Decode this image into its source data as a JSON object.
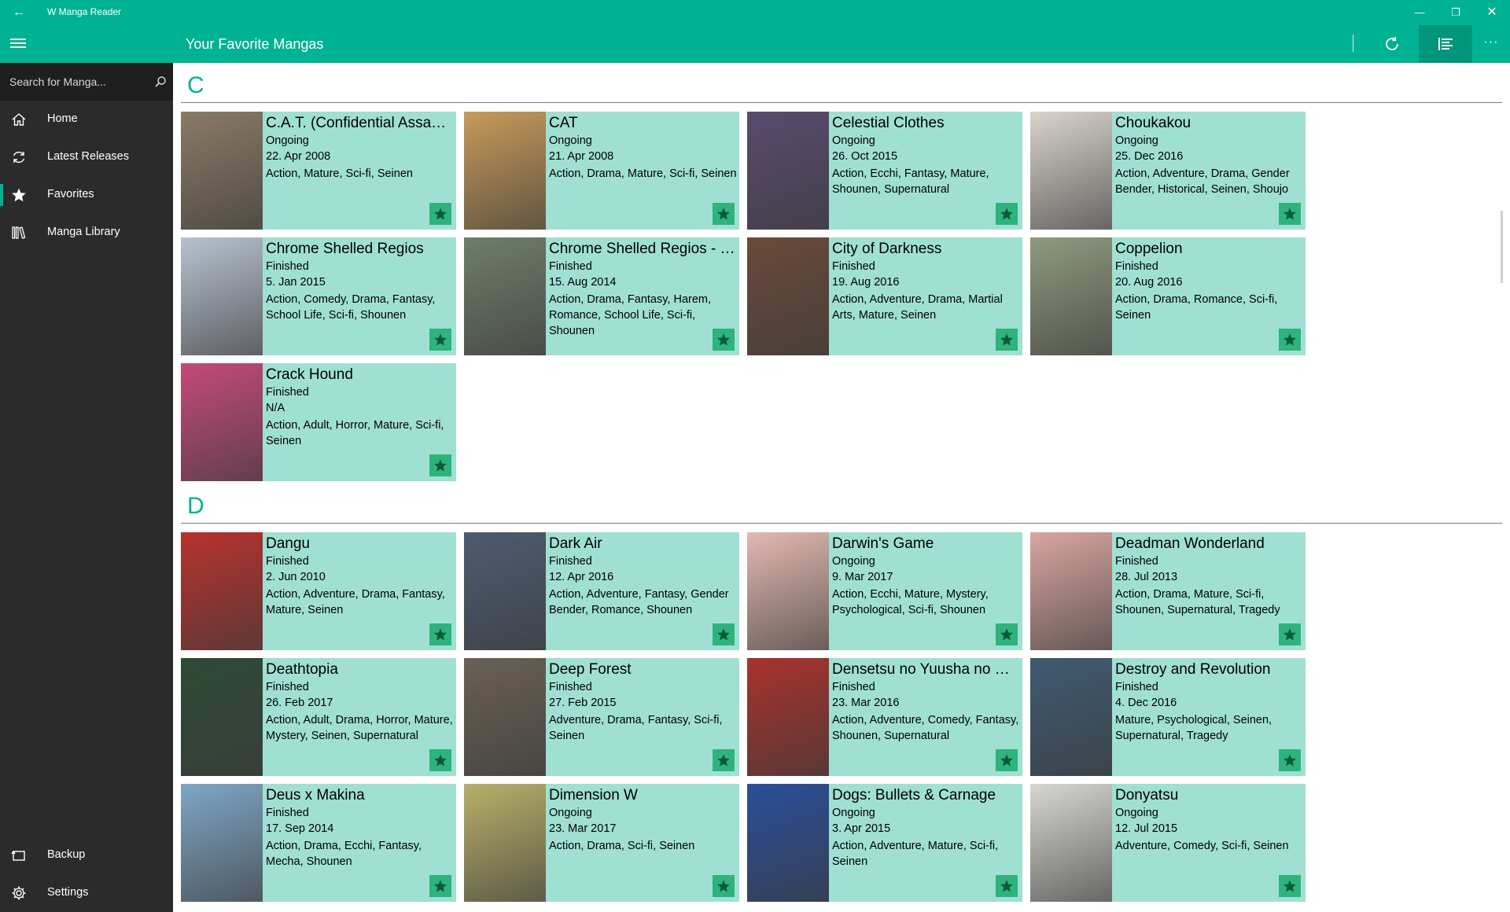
{
  "app": {
    "title": "W Manga Reader"
  },
  "header": {
    "page_title": "Your Favorite Mangas"
  },
  "colors": {
    "accent": "#00b294",
    "card_bg": "#9fe0d3",
    "star_bg": "#2fb37c",
    "sidebar_bg": "#2b2b2b"
  },
  "sidebar": {
    "search_placeholder": "Search for Manga...",
    "items": [
      {
        "label": "Home",
        "icon": "home-icon"
      },
      {
        "label": "Latest Releases",
        "icon": "refresh-icon"
      },
      {
        "label": "Favorites",
        "icon": "star-icon",
        "selected": true
      },
      {
        "label": "Manga Library",
        "icon": "library-icon"
      }
    ],
    "bottom_items": [
      {
        "label": "Backup",
        "icon": "backup-icon"
      },
      {
        "label": "Settings",
        "icon": "gear-icon"
      }
    ]
  },
  "groups": [
    {
      "letter": "C",
      "mangas": [
        {
          "title": "C.A.T. (Confidential Assassination Troop)",
          "status": "Ongoing",
          "date": "22. Apr 2008",
          "genres": "Action, Mature, Sci-fi, Seinen",
          "cover_color": "#8a7a66"
        },
        {
          "title": "CAT",
          "status": "Ongoing",
          "date": "21. Apr 2008",
          "genres": "Action, Drama, Mature, Sci-fi, Seinen",
          "cover_color": "#c79a5a"
        },
        {
          "title": "Celestial Clothes",
          "status": "Ongoing",
          "date": "26. Oct 2015",
          "genres": "Action, Ecchi, Fantasy, Mature, Shounen, Supernatural",
          "cover_color": "#5a4b6e"
        },
        {
          "title": "Choukakou",
          "status": "Ongoing",
          "date": "25. Dec 2016",
          "genres": "Action, Adventure, Drama, Gender Bender, Historical, Seinen, Shoujo",
          "cover_color": "#d9d4cc"
        },
        {
          "title": "Chrome Shelled Regios",
          "status": "Finished",
          "date": "5. Jan 2015",
          "genres": "Action, Comedy, Drama, Fantasy, School Life, Sci-fi, Shounen",
          "cover_color": "#b8c2cf"
        },
        {
          "title": "Chrome Shelled Regios - Missing Mail",
          "status": "Finished",
          "date": "15. Aug 2014",
          "genres": "Action, Drama, Fantasy, Harem, Romance, School Life, Sci-fi, Shounen",
          "cover_color": "#6f7d6a"
        },
        {
          "title": "City of Darkness",
          "status": "Finished",
          "date": "19. Aug 2016",
          "genres": "Action, Adventure, Drama, Martial Arts, Mature, Seinen",
          "cover_color": "#6b4a3a"
        },
        {
          "title": "Coppelion",
          "status": "Finished",
          "date": "20. Aug 2016",
          "genres": "Action, Drama, Romance, Sci-fi, Seinen",
          "cover_color": "#8f9a7e"
        },
        {
          "title": "Crack Hound",
          "status": "Finished",
          "date": "N/A",
          "genres": "Action, Adult, Horror, Mature, Sci-fi, Seinen",
          "cover_color": "#c44a7a"
        }
      ]
    },
    {
      "letter": "D",
      "mangas": [
        {
          "title": "Dangu",
          "status": "Finished",
          "date": "2. Jun 2010",
          "genres": "Action, Adventure, Drama, Fantasy, Mature, Seinen",
          "cover_color": "#b8322e"
        },
        {
          "title": "Dark Air",
          "status": "Finished",
          "date": "12. Apr 2016",
          "genres": "Action, Adventure, Fantasy, Gender Bender, Romance, Shounen",
          "cover_color": "#4d5b70"
        },
        {
          "title": "Darwin's Game",
          "status": "Ongoing",
          "date": "9. Mar 2017",
          "genres": "Action, Ecchi, Mature, Mystery, Psychological, Sci-fi, Shounen",
          "cover_color": "#e3b9b0"
        },
        {
          "title": "Deadman Wonderland",
          "status": "Finished",
          "date": "28. Jul 2013",
          "genres": "Action, Drama, Mature, Sci-fi, Shounen, Supernatural, Tragedy",
          "cover_color": "#d8a6a0"
        },
        {
          "title": "Deathtopia",
          "status": "Finished",
          "date": "26. Feb 2017",
          "genres": "Action, Adult, Drama, Horror, Mature, Mystery, Seinen, Supernatural",
          "cover_color": "#2e4a36"
        },
        {
          "title": "Deep Forest",
          "status": "Finished",
          "date": "27. Feb 2015",
          "genres": "Adventure, Drama, Fantasy, Sci-fi, Seinen",
          "cover_color": "#6a6055"
        },
        {
          "title": "Densetsu no Yuusha no Densetsu",
          "status": "Finished",
          "date": "23. Mar 2016",
          "genres": "Action, Adventure, Comedy, Fantasy, Shounen, Supernatural",
          "cover_color": "#a8322c"
        },
        {
          "title": "Destroy and Revolution",
          "status": "Finished",
          "date": "4. Dec 2016",
          "genres": "Mature, Psychological, Seinen, Supernatural, Tragedy",
          "cover_color": "#3f5a72"
        },
        {
          "title": "Deus x Makina",
          "status": "Finished",
          "date": "17. Sep 2014",
          "genres": "Action, Drama, Ecchi, Fantasy, Mecha, Shounen",
          "cover_color": "#7fa6c6"
        },
        {
          "title": "Dimension W",
          "status": "Ongoing",
          "date": "23. Mar 2017",
          "genres": "Action, Drama, Sci-fi, Seinen",
          "cover_color": "#b7b06a"
        },
        {
          "title": "Dogs: Bullets & Carnage",
          "status": "Ongoing",
          "date": "3. Apr 2015",
          "genres": "Action, Adventure, Mature, Sci-fi, Seinen",
          "cover_color": "#2a4e9a"
        },
        {
          "title": "Donyatsu",
          "status": "Ongoing",
          "date": "12. Jul 2015",
          "genres": "Adventure, Comedy, Sci-fi, Seinen",
          "cover_color": "#d7d7d2"
        }
      ]
    }
  ]
}
